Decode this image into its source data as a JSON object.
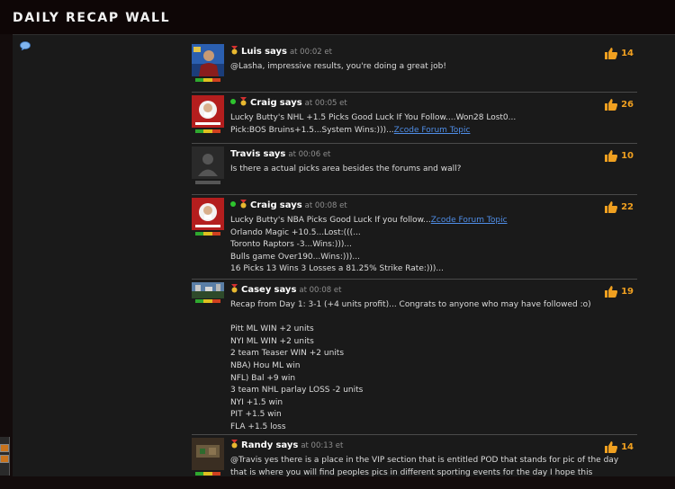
{
  "header": {
    "title": "DAILY RECAP WALL"
  },
  "feed": {
    "says_label": "says",
    "posts": [
      {
        "author": "Luis",
        "online": false,
        "time": "at 00:02 et",
        "likes": "14",
        "avatar": "luis-photo-avatar",
        "lines": [
          "@Lasha, impressive results, you're doing a great job!"
        ]
      },
      {
        "author": "Craig",
        "online": true,
        "time": "at 00:05 et",
        "likes": "26",
        "avatar": "craig-logo-avatar",
        "lines": [
          "Lucky Butty's NHL +1.5 Picks Good Luck If You Follow....Won28 Lost0...",
          "Pick:BOS Bruins+1.5...System Wins:)))..."
        ],
        "link_text": "Zcode Forum Topic"
      },
      {
        "author": "Travis",
        "online": false,
        "time": "at 00:06 et",
        "likes": "10",
        "avatar": "default-user-avatar",
        "lines": [
          "Is there a actual picks area besides the forums and wall?"
        ]
      },
      {
        "author": "Craig",
        "online": true,
        "time": "at 00:08 et",
        "likes": "22",
        "avatar": "craig-logo-avatar",
        "first_line": "Lucky Butty's NBA Picks Good Luck If you follow...",
        "link_text": "Zcode Forum Topic",
        "lines": [
          "Orlando Magic +10.5...Lost:(((...",
          "Toronto Raptors -3...Wins:)))...",
          "Bulls game Over190...Wins:)))...",
          "16 Picks 13 Wins 3 Losses a 81.25% Strike Rate:)))..."
        ]
      },
      {
        "author": "Casey",
        "online": false,
        "time": "at 00:08 et",
        "likes": "19",
        "avatar": "casey-stadium-avatar",
        "lines": [
          "Recap from Day 1: 3-1 (+4 units profit)... Congrats to anyone who may have followed :o)",
          "",
          "Pitt ML WIN +2 units",
          "NYI ML WIN +2 units",
          "2 team Teaser WIN +2 units",
          "NBA) Hou ML win",
          "NFL) Bal +9 win",
          "3 team NHL parlay LOSS -2 units",
          "NYI +1.5 win",
          "PIT +1.5 win",
          "FLA +1.5 loss"
        ]
      },
      {
        "author": "Randy",
        "online": false,
        "time": "at 00:13 et",
        "likes": "14",
        "avatar": "randy-photo-avatar",
        "lines": [
          "@Travis yes there is a place in the VIP section that is entitled POD that stands for pic of the day",
          "that is where you will find peoples pics in different sporting events for the day I hope this"
        ]
      }
    ]
  },
  "colors": {
    "like_count": "#f0a020",
    "link": "#4f8de6",
    "online_dot": "#2ec42e",
    "rep_green": "#2fa82f",
    "rep_yellow": "#e0c020",
    "rep_red": "#d04020"
  }
}
